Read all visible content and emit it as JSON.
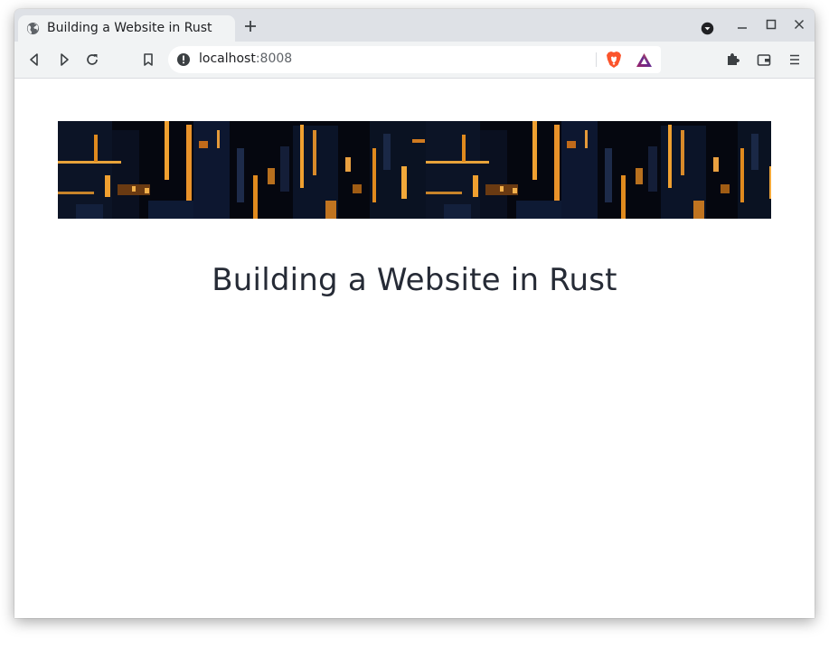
{
  "browser": {
    "tab": {
      "title": "Building a Website in Rust",
      "favicon": "globe-icon"
    },
    "controls": {
      "new_tab": "plus-icon",
      "tab_search": "chevron-down-circle-icon",
      "minimize": "minimize-icon",
      "maximize": "maximize-icon",
      "close": "close-icon"
    },
    "toolbar": {
      "back": "back-icon",
      "forward": "forward-icon",
      "reload": "reload-icon",
      "bookmark": "bookmark-icon",
      "extensions": "puzzle-icon",
      "wallet": "wallet-icon",
      "menu": "hamburger-menu-icon"
    },
    "omnibox": {
      "host": "localhost",
      "port": ":8008",
      "site_info": "info-icon",
      "shields": "brave-lion-icon",
      "rewards": "brave-rewards-icon"
    }
  },
  "page": {
    "banner": {
      "description_icon": "city-night-banner"
    },
    "heading": "Building a Website in Rust"
  },
  "colors": {
    "tabstrip": "#dee1e6",
    "toolbar": "#f1f3f4",
    "heading": "#262b36",
    "banner_dark": "#05070f",
    "banner_light": "#e08a1e",
    "brave_orange": "#fb542b"
  }
}
